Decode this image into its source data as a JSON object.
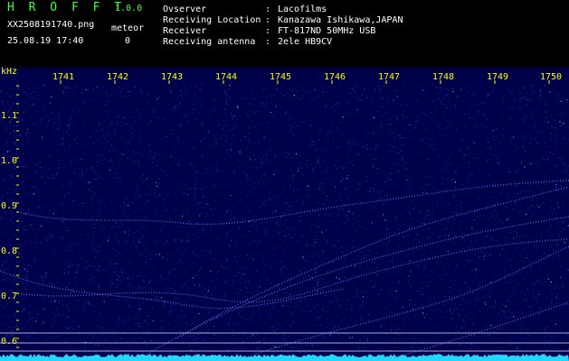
{
  "header": {
    "app_name": "H R O F F T",
    "version": "1.0.0",
    "filename": "XX2508191740.png",
    "datetime": "25.08.19 17:40",
    "meteor_label": "meteor",
    "meteor_count": "0",
    "info": [
      {
        "label": "Ovserver",
        "value": "Lacofilms"
      },
      {
        "label": "Receiving Location",
        "value": "Kanazawa Ishikawa,JAPAN"
      },
      {
        "label": "Receiver",
        "value": "FT-817ND 50MHz USB"
      },
      {
        "label": "Receiving antenna",
        "value": "2ele HB9CV"
      }
    ]
  },
  "spectrogram": {
    "freq_unit": "kHz",
    "time_labels": [
      "1741",
      "1742",
      "1743",
      "1744",
      "1745",
      "1746",
      "1747",
      "1748",
      "1749",
      "1750"
    ],
    "freq_labels": [
      "1.1",
      "1.0",
      "0.9",
      "0.8",
      "0.7",
      "0.6"
    ],
    "colors": {
      "background": "#00004a",
      "noise": "#3a48ff",
      "trace": "#6f7dff",
      "baseline": "#22d6ff",
      "scale_text": "#ffff00",
      "header_green": "#39ff39"
    }
  }
}
